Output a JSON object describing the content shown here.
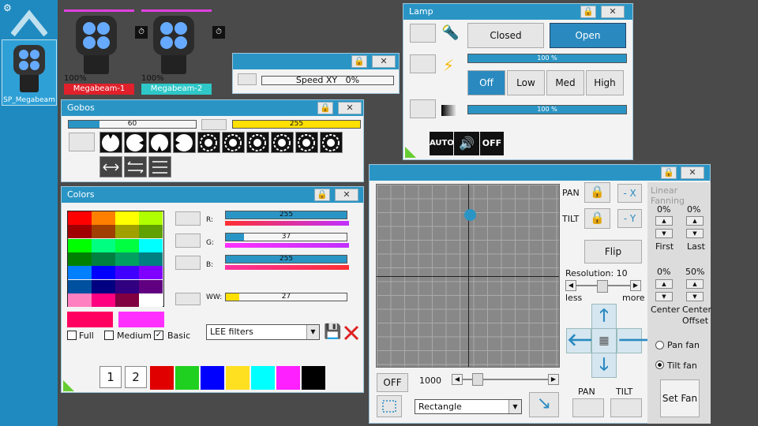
{
  "sidebar": {
    "fixture_label": "SP_Megabeam",
    "gear_icon": "gear-icon"
  },
  "fixtures": [
    {
      "pct": "100%",
      "name": "Megabeam-1",
      "color": "#e0202a"
    },
    {
      "pct": "100%",
      "name": "Megabeam-2",
      "color": "#2ec8c8"
    }
  ],
  "speed": {
    "label": "Speed XY",
    "value": "0%"
  },
  "gobos": {
    "title": "Gobos",
    "bar1": "60",
    "bar1_level": 0.24,
    "bar2": "255",
    "bar2_level": 1.0
  },
  "colors": {
    "title": "Colors",
    "r": "255",
    "r_level": 1.0,
    "g": "37",
    "g_level": 0.15,
    "b": "255",
    "b_level": 1.0,
    "ww": "27",
    "ww_level": 0.11,
    "r_label": "R:",
    "g_label": "G:",
    "b_label": "B:",
    "ww_label": "WW:",
    "full": "Full",
    "medium": "Medium",
    "basic": "Basic",
    "filter": "LEE filters",
    "page1": "1",
    "page2": "2",
    "grid": [
      "#ff0000",
      "#ff8000",
      "#ffff00",
      "#b0ff00",
      "#a00000",
      "#a04000",
      "#a0a000",
      "#60a000",
      "#00ff00",
      "#00ff80",
      "#00ff40",
      "#00ffff",
      "#008000",
      "#008040",
      "#00a060",
      "#008080",
      "#0080ff",
      "#0000ff",
      "#4000ff",
      "#8000ff",
      "#0050a0",
      "#000080",
      "#300080",
      "#600080",
      "#ff80c0",
      "#ff0080",
      "#800040",
      "#ffffff"
    ],
    "presets": [
      "#ff0060",
      "#ff30ff"
    ],
    "quick": [
      "#e00000",
      "#20d020",
      "#0000ff",
      "#ffe020",
      "#00ffff",
      "#ff20ff",
      "#000000"
    ]
  },
  "lamp": {
    "title": "Lamp",
    "closed": "Closed",
    "open": "Open",
    "bar1": "100 %",
    "bar2": "100 %",
    "off": "Off",
    "low": "Low",
    "med": "Med",
    "high": "High",
    "auto": "AUTO",
    "off2": "OFF"
  },
  "xy": {
    "pan": "PAN",
    "tilt": "TILT",
    "minus_x": "- X",
    "minus_y": "- Y",
    "flip": "Flip",
    "resolution": "Resolution: 10",
    "less": "less",
    "more": "more",
    "off": "OFF",
    "speed_value": "1000",
    "shape": "Rectangle",
    "pan_bottom": "PAN",
    "tilt_bottom": "TILT",
    "dot_x": 0.505,
    "dot_y": 0.165
  },
  "fanning": {
    "title": "Linear Fanning",
    "first_pct": "0%",
    "last_pct": "0%",
    "first": "First",
    "last": "Last",
    "center_pct": "0%",
    "offset_pct": "50%",
    "center": "Center",
    "center_offset": "Center\nOffset",
    "pan_fan": "Pan fan",
    "tilt_fan": "Tilt fan",
    "set_fan": "Set Fan"
  }
}
